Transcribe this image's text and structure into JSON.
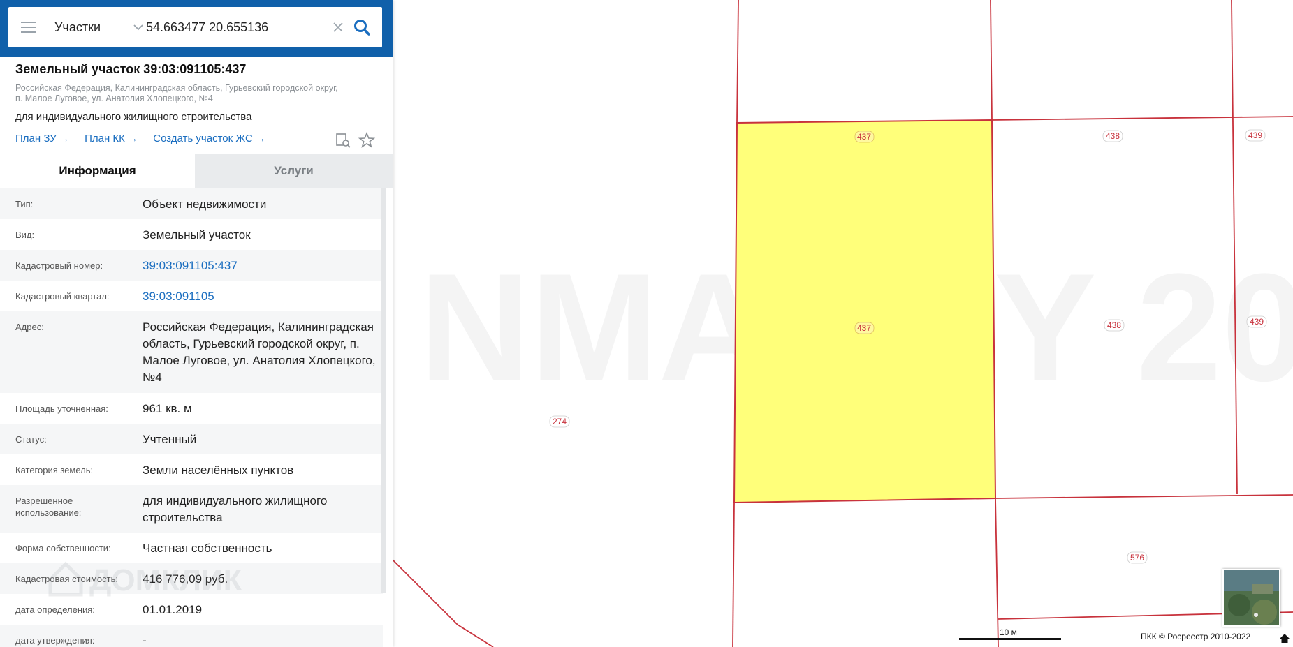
{
  "search": {
    "layer_label": "Участки",
    "query": "54.663477 20.655136"
  },
  "object": {
    "title": "Земельный участок 39:03:091105:437",
    "address_line1": "Российская Федерация, Калининградская область, Гурьевский городской округ,",
    "address_line2": "п. Малое Луговое, ул. Анатолия Хлопецкого, №4",
    "use": "для индивидуального жилищного строительства"
  },
  "links": {
    "plan_zu": "План ЗУ",
    "plan_kk": "План КК",
    "create_zs": "Создать участок ЖС"
  },
  "tabs": {
    "info": "Информация",
    "services": "Услуги"
  },
  "details": {
    "type": {
      "key": "Тип:",
      "value": "Объект недвижимости"
    },
    "kind": {
      "key": "Вид:",
      "value": "Земельный участок"
    },
    "cad_num": {
      "key": "Кадастровый номер:",
      "value": "39:03:091105:437"
    },
    "cad_block": {
      "key": "Кадастровый квартал:",
      "value": "39:03:091105"
    },
    "address": {
      "key": "Адрес:",
      "value": "Российская Федерация, Калининградская область, Гурьевский городской округ, п. Малое Луговое, ул. Анатолия Хлопецкого, №4"
    },
    "area": {
      "key": "Площадь уточненная:",
      "value": "961 кв. м"
    },
    "status": {
      "key": "Статус:",
      "value": "Учтенный"
    },
    "category": {
      "key": "Категория земель:",
      "value": "Земли населённых пунктов"
    },
    "permitted_use": {
      "key": "Разрешенное использование:",
      "value": "для индивидуального жилищного строительства"
    },
    "ownership": {
      "key": "Форма собственности:",
      "value": "Частная собственность"
    },
    "cad_value": {
      "key": "Кадастровая стоимость:",
      "value": "416 776,09 руб."
    },
    "date_determined": {
      "key": "дата определения:",
      "value": "01.01.2019"
    },
    "date_approved": {
      "key": "дата утверждения:",
      "value": "-"
    }
  },
  "map": {
    "parcel_labels": [
      "437",
      "437",
      "438",
      "438",
      "439",
      "439",
      "274",
      "576"
    ],
    "scale_label": "10 м",
    "copyright": "ПКК © Росреестр 2010-2022",
    "watermark": "ДОМКЛИК"
  },
  "colors": {
    "header_blue": "#1060aa",
    "link_blue": "#1b6ec0",
    "parcel_border": "#c8323c",
    "selected_fill": "#ffff7a"
  }
}
